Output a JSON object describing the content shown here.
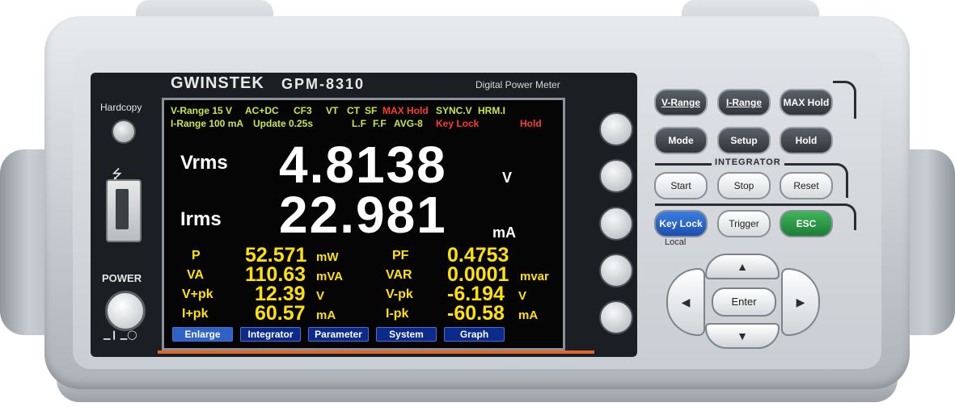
{
  "device": {
    "brand": "GWINSTEK",
    "model": "GPM-8310",
    "subtitle": "Digital Power Meter"
  },
  "left_panel": {
    "hardcopy_label": "Hardcopy",
    "power_label": "POWER",
    "power_symbols": "▁❙ ▁◯"
  },
  "screen": {
    "status": {
      "row1": [
        "V-Range 15 V",
        "AC+DC",
        "CF3",
        "VT",
        "CT",
        "SF",
        "MAX Hold",
        "SYNC.V",
        "HRM.I"
      ],
      "row2": [
        "I-Range 100 mA",
        "Update 0.25s",
        "L.F",
        "F.F",
        "AVG-8",
        "Key Lock",
        "Hold"
      ]
    },
    "primary": [
      {
        "label": "Vrms",
        "value": "4.8138",
        "unit": "V"
      },
      {
        "label": "Irms",
        "value": "22.981",
        "unit": "mA"
      }
    ],
    "measurements": [
      {
        "label": "P",
        "value": "52.571",
        "unit": "mW"
      },
      {
        "label": "PF",
        "value": "0.4753",
        "unit": ""
      },
      {
        "label": "VA",
        "value": "110.63",
        "unit": "mVA"
      },
      {
        "label": "VAR",
        "value": "0.0001",
        "unit": "mvar"
      },
      {
        "label": "V+pk",
        "value": "12.39",
        "unit": "V"
      },
      {
        "label": "V-pk",
        "value": "-6.194",
        "unit": "V"
      },
      {
        "label": "I+pk",
        "value": "60.57",
        "unit": "mA"
      },
      {
        "label": "I-pk",
        "value": "-60.58",
        "unit": "mA"
      }
    ],
    "softkeys": [
      "Enlarge",
      "Integrator",
      "Parameter",
      "System",
      "Graph"
    ]
  },
  "right_panel": {
    "row1": [
      "V-Range",
      "I-Range",
      "MAX Hold"
    ],
    "row2": [
      "Mode",
      "Setup",
      "Hold"
    ],
    "integrator_label": "INTEGRATOR",
    "row3": [
      "Start",
      "Stop",
      "Reset"
    ],
    "row4": [
      "Key Lock",
      "Trigger",
      "ESC"
    ],
    "local_label": "Local",
    "enter_label": "Enter"
  },
  "icons": {
    "usb": "usb-icon",
    "arrows": [
      "arrow-up-icon",
      "arrow-down-icon",
      "arrow-left-icon",
      "arrow-right-icon"
    ]
  },
  "colors": {
    "status_green": "#c8e64a",
    "status_red": "#ff3b2f",
    "measure_yellow": "#ffe200",
    "accent_orange": "#e0662b",
    "esc_green": "#2a9a45",
    "keylock_blue": "#2a66c8"
  }
}
